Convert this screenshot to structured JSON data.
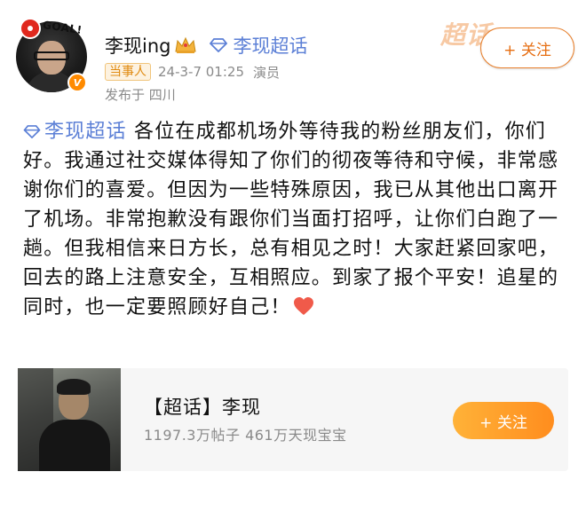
{
  "header": {
    "user_name": "李现ing",
    "topic": "李现超话",
    "tag": "当事人",
    "timestamp": "24-3-7 01:25",
    "role": "演员",
    "location": "发布于 四川",
    "watermark": "超话",
    "follow_label": "+ 关注",
    "avatar_badge": "GOAL!"
  },
  "post": {
    "topic": "李现超话",
    "body": " 各位在成都机场外等待我的粉丝朋友们，你们好。我通过社交媒体得知了你们的彻夜等待和守候，非常感谢你们的喜爱。但因为一些特殊原因，我已从其他出口离开了机场。非常抱歉没有跟你们当面打招呼，让你们白跑了一趟。但我相信来日方长，总有相见之时！大家赶紧回家吧，回去的路上注意安全，互相照应。到家了报个平安！追星的同时，也一定要照顾好自己！"
  },
  "card": {
    "title": "【超话】李现",
    "stats": "1197.3万帖子 461万天现宝宝",
    "follow_label": "+ 关注"
  },
  "colors": {
    "accent_orange": "#ff8d1e",
    "topic_blue": "#5b7fd6",
    "meta_gray": "#8a8a8a"
  }
}
